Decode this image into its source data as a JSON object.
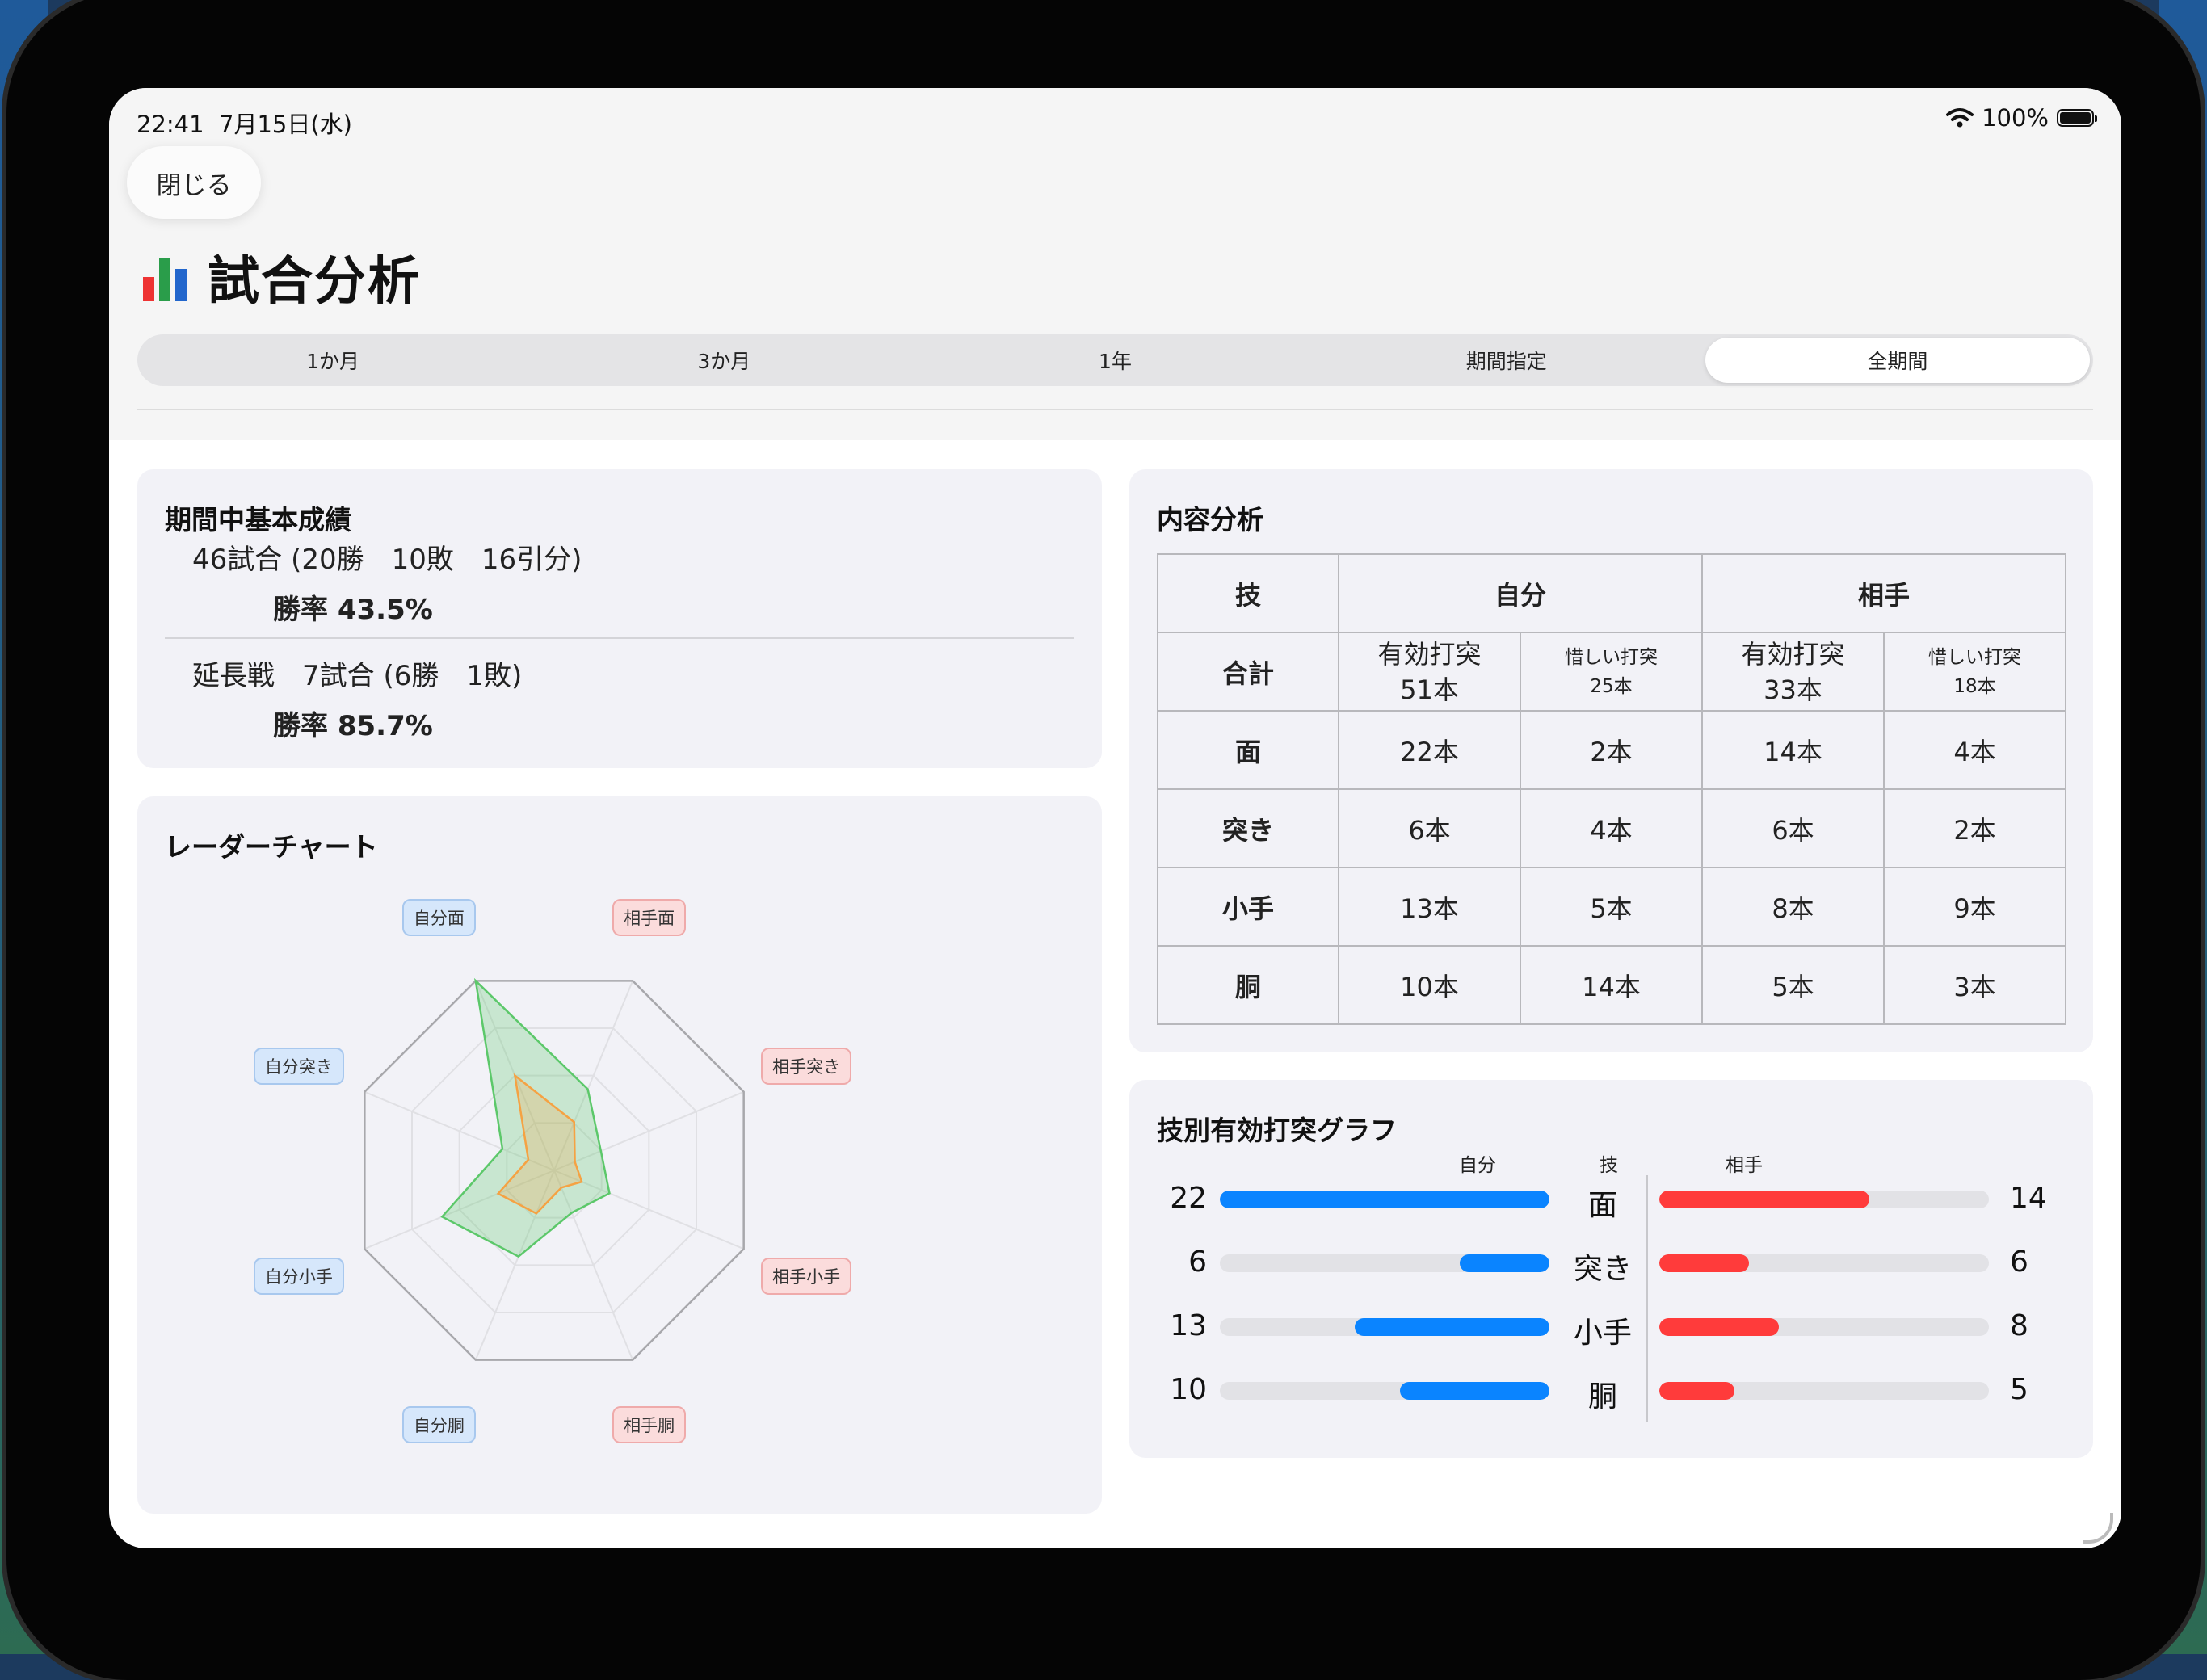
{
  "status": {
    "time": "22:41",
    "date": "7月15日(水)",
    "battery": "100%"
  },
  "close_label": "閉じる",
  "title": "試合分析",
  "periods": [
    "1か月",
    "3か月",
    "1年",
    "期間指定",
    "全期間"
  ],
  "selected_period": "全期間",
  "basic": {
    "title": "期間中基本成績",
    "record": "46試合 (20勝　10敗　16引分)",
    "win_rate": "勝率 43.5%",
    "extra_record": "延長戦　7試合 (6勝　1敗)",
    "extra_win_rate": "勝率 85.7%"
  },
  "radar": {
    "title": "レーダーチャート",
    "labels": [
      "自分面",
      "相手面",
      "相手突き",
      "相手小手",
      "相手胴",
      "自分胴",
      "自分小手",
      "自分突き"
    ],
    "series_self": [
      22,
      6,
      13,
      10
    ],
    "series_opp": [
      14,
      6,
      8,
      5
    ],
    "colors": {
      "self": "#5cc86a",
      "opp": "#f5a243"
    }
  },
  "content": {
    "title": "内容分析",
    "h_tech": "技",
    "h_self": "自分",
    "h_opp": "相手",
    "total_label": "合計",
    "self_valid": "有効打突\n51本",
    "self_near": "惜しい打突\n25本",
    "opp_valid": "有効打突\n33本",
    "opp_near": "惜しい打突\n18本",
    "rows": [
      {
        "tech": "面",
        "self_valid": "22本",
        "self_near": "2本",
        "opp_valid": "14本",
        "opp_near": "4本"
      },
      {
        "tech": "突き",
        "self_valid": "6本",
        "self_near": "4本",
        "opp_valid": "6本",
        "opp_near": "2本"
      },
      {
        "tech": "小手",
        "self_valid": "13本",
        "self_near": "5本",
        "opp_valid": "8本",
        "opp_near": "9本"
      },
      {
        "tech": "胴",
        "self_valid": "10本",
        "self_near": "14本",
        "opp_valid": "5本",
        "opp_near": "3本"
      }
    ]
  },
  "bars": {
    "title": "技別有効打突グラフ",
    "head_self": "自分",
    "head_tech": "技",
    "head_opp": "相手",
    "max": 22,
    "rows": [
      {
        "tech": "面",
        "self": 22,
        "opp": 14
      },
      {
        "tech": "突き",
        "self": 6,
        "opp": 6
      },
      {
        "tech": "小手",
        "self": 13,
        "opp": 8
      },
      {
        "tech": "胴",
        "self": 10,
        "opp": 5
      }
    ],
    "colors": {
      "self": "#0a84ff",
      "opp": "#ff3b3b"
    }
  }
}
